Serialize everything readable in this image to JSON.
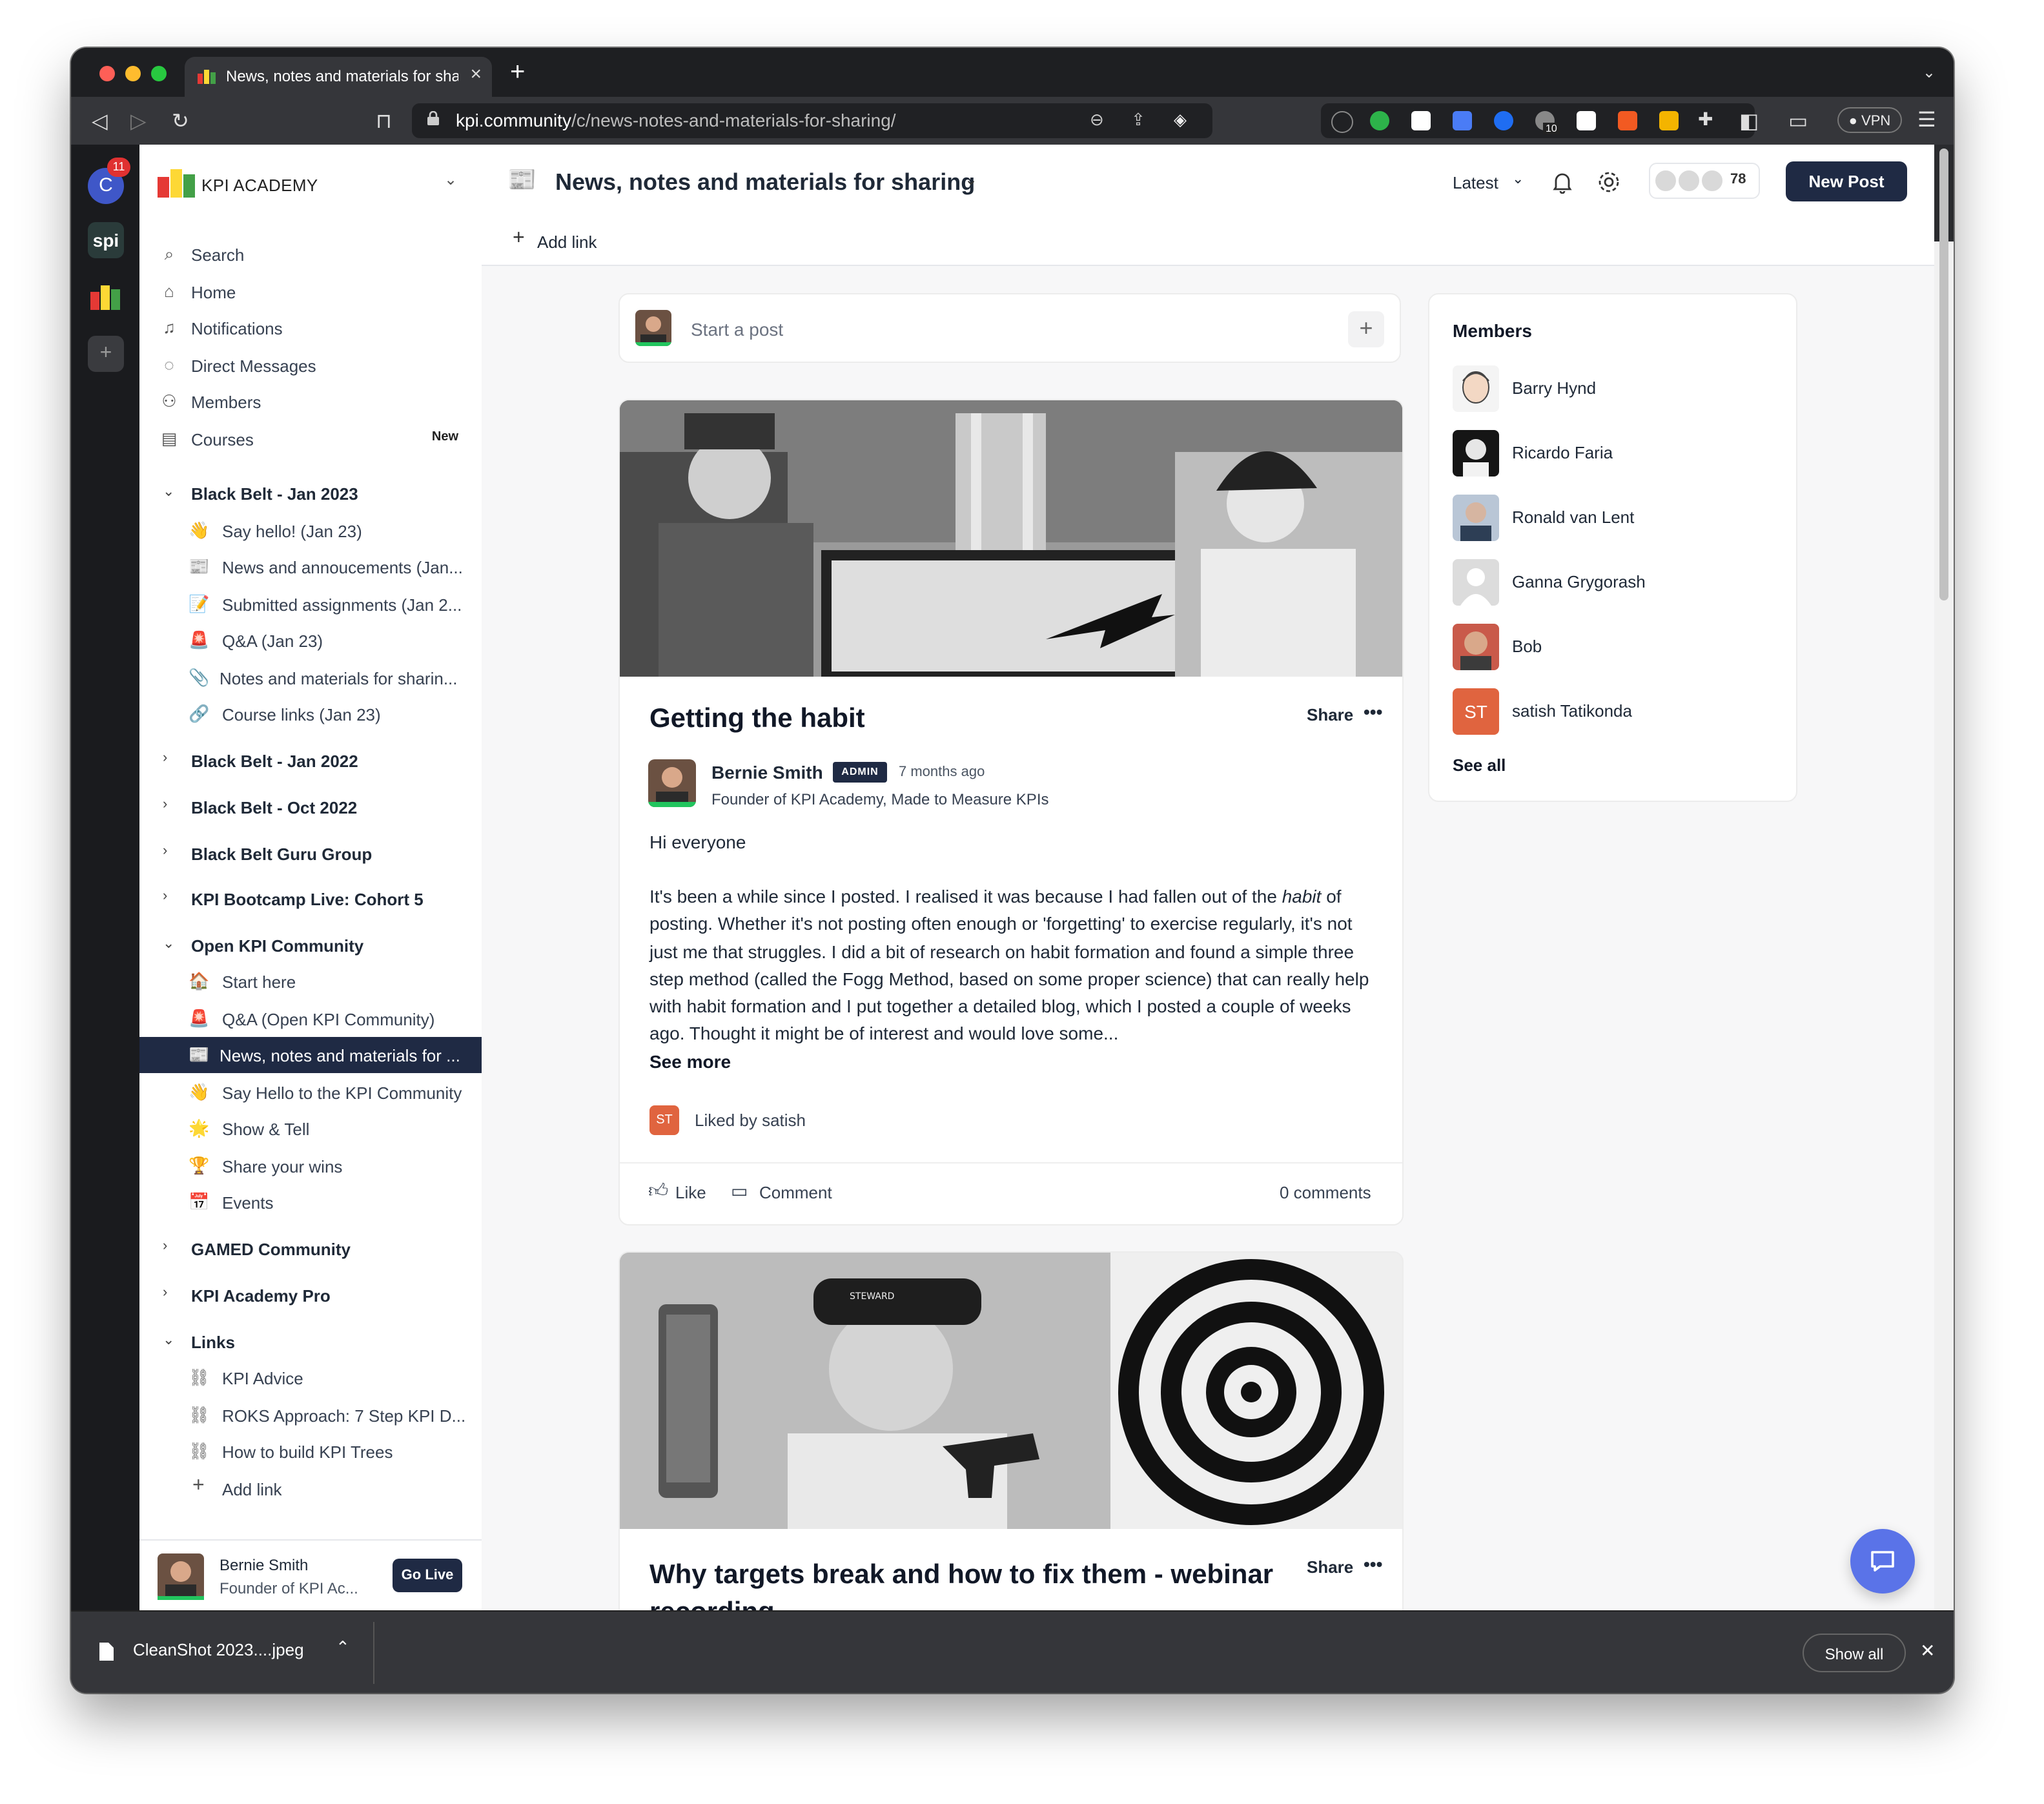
{
  "browser": {
    "tab_title": "News, notes and materials for sharing",
    "tab_close": "×",
    "new_tab": "+",
    "url_host": "kpi.community",
    "url_path": "/c/news-notes-and-materials-for-sharing/",
    "ext_badge": "10",
    "vpn": "● VPN"
  },
  "rail": {
    "user_initial": "C",
    "badge": "11",
    "spi": "spi"
  },
  "sidebar": {
    "brand": "KPI ACADEMY",
    "nav": [
      {
        "label": "Search"
      },
      {
        "label": "Home"
      },
      {
        "label": "Notifications"
      },
      {
        "label": "Direct Messages"
      },
      {
        "label": "Members"
      },
      {
        "label": "Courses",
        "badge": "New"
      }
    ],
    "groups": {
      "bb_jan_2023": "Black Belt - Jan 2023",
      "bb_jan_2022": "Black Belt - Jan 2022",
      "bb_oct_2022": "Black Belt - Oct 2022",
      "bb_guru": "Black Belt Guru Group",
      "bootcamp": "KPI Bootcamp Live: Cohort 5",
      "open_kpi": "Open KPI Community",
      "gamed": "GAMED Community",
      "pro": "KPI Academy Pro",
      "links": "Links"
    },
    "bb_jan_2023_items": [
      "Say hello! (Jan 23)",
      "News and annoucements (Jan...",
      "Submitted assignments (Jan 2...",
      "Q&A (Jan 23)",
      "Notes and materials for sharin...",
      "Course links (Jan 23)"
    ],
    "open_kpi_items": [
      "Start here",
      "Q&A (Open KPI Community)",
      "News, notes and materials for ...",
      "Say Hello to the KPI Community",
      "Show & Tell",
      "Share your wins",
      "Events"
    ],
    "links_items": [
      "KPI Advice",
      "ROKS Approach: 7 Step KPI D...",
      "How to build KPI Trees",
      "Add link"
    ],
    "user": {
      "name": "Bernie Smith",
      "headline": "Founder of KPI Ac...",
      "go_live": "Go Live"
    }
  },
  "header": {
    "title": "News, notes and materials for sharing",
    "sort": "Latest",
    "member_count": "78",
    "new_post": "New Post",
    "add_link": "Add link"
  },
  "composer": {
    "placeholder": "Start a post",
    "plus": "+"
  },
  "post1": {
    "title": "Getting the habit",
    "share": "Share",
    "more": "•••",
    "author": "Bernie Smith",
    "admin": "ADMIN",
    "time": "7 months ago",
    "headline": "Founder of KPI Academy, Made to Measure KPIs",
    "greeting": "Hi everyone",
    "body_before": "It's been a while since I posted. I realised it was because I had fallen out of the ",
    "body_em": "habit",
    "body_after": " of posting. Whether it's not posting often enough or 'forgetting' to exercise regularly, it's not just me that struggles. I did a bit of research on habit formation and found a simple three step method (called the Fogg Method, based on some proper science) that can really help with habit formation and I put together a detailed blog, which I posted a couple of weeks ago. Thought it might be of interest and would love some...",
    "see_more": "See more",
    "liked_initials": "ST",
    "liked_by": "Liked by satish",
    "like": "Like",
    "comment": "Comment",
    "comments_count": "0 comments"
  },
  "post2": {
    "title": "Why targets break and how to fix them - webinar recording",
    "share": "Share",
    "more": "•••",
    "cap_text": "STEWARD"
  },
  "members": {
    "title": "Members",
    "list": [
      {
        "name": "Barry Hynd"
      },
      {
        "name": "Ricardo Faria"
      },
      {
        "name": "Ronald van Lent"
      },
      {
        "name": "Ganna Grygorash"
      },
      {
        "name": "Bob"
      },
      {
        "name": "satish Tatikonda",
        "initials": "ST"
      }
    ],
    "see_all": "See all"
  },
  "download_bar": {
    "file": "CleanShot 2023....jpeg",
    "show_all": "Show all",
    "close": "✕"
  }
}
